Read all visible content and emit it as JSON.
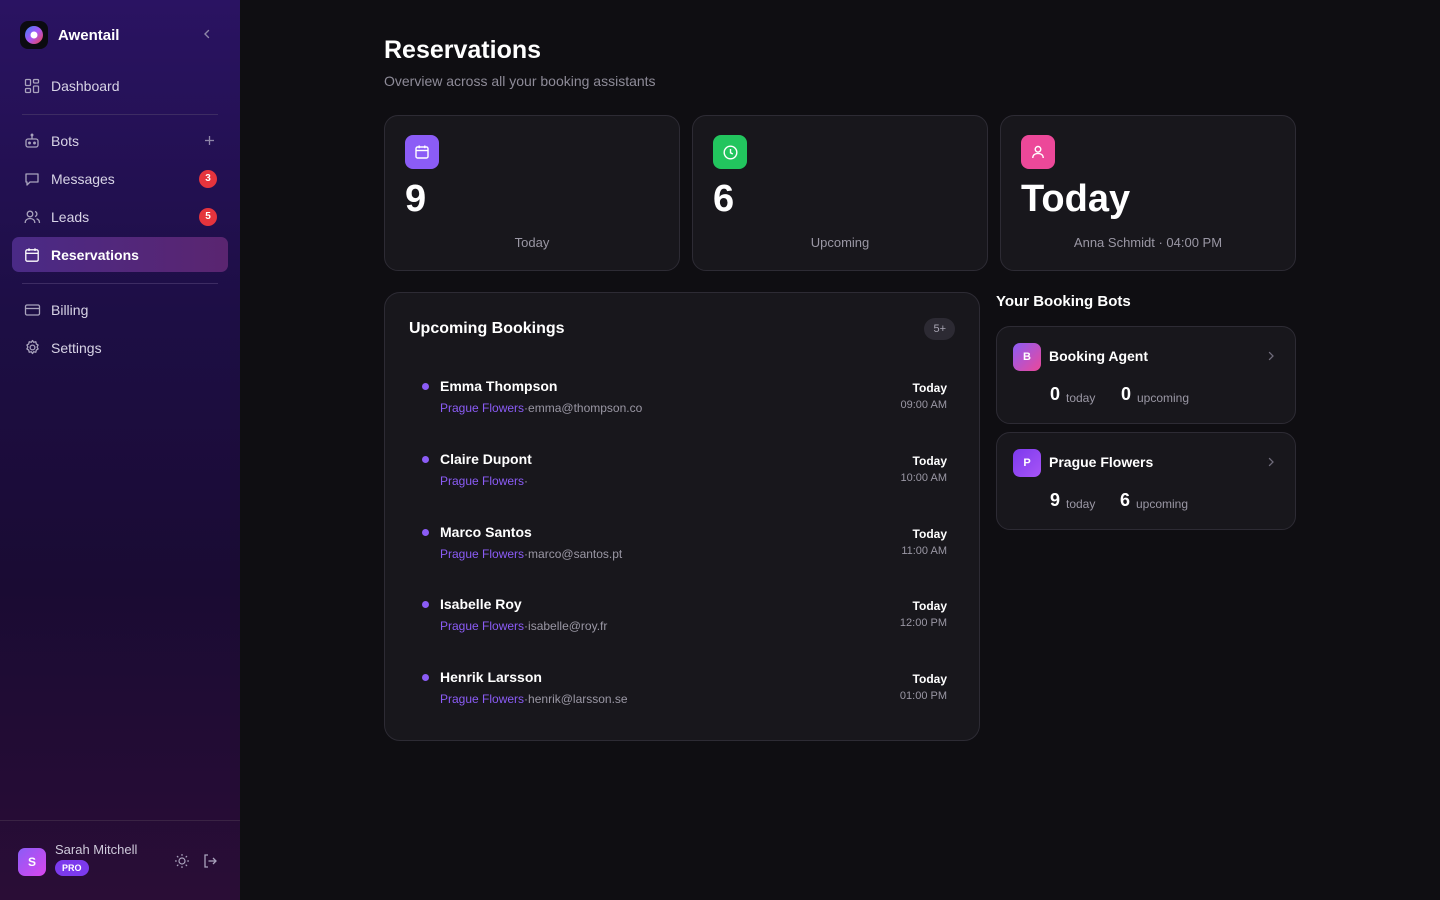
{
  "app": {
    "name": "Awentail"
  },
  "sidebar": {
    "items": [
      {
        "label": "Dashboard"
      },
      {
        "label": "Bots"
      },
      {
        "label": "Messages",
        "badge": "3"
      },
      {
        "label": "Leads",
        "badge": "5"
      },
      {
        "label": "Reservations"
      },
      {
        "label": "Billing"
      },
      {
        "label": "Settings"
      }
    ],
    "active": "Reservations"
  },
  "user": {
    "name": "Sarah Mitchell",
    "initial": "S",
    "plan": "PRO"
  },
  "page": {
    "title": "Reservations",
    "subtitle": "Overview across all your booking assistants"
  },
  "stats": [
    {
      "value": "9",
      "label": "Today",
      "icon": "calendar-icon",
      "color": "#8b5cf6"
    },
    {
      "value": "6",
      "label": "Upcoming",
      "icon": "clock-icon",
      "color": "#22c55e"
    },
    {
      "value": "Today",
      "label": "Anna Schmidt · 04:00 PM",
      "icon": "user-icon",
      "color": "#ec4899"
    }
  ],
  "bookings": {
    "title": "Upcoming Bookings",
    "count": "5+",
    "items": [
      {
        "name": "Emma Thompson",
        "bot": "Prague Flowers",
        "sep": "·",
        "email": "emma@thompson.co",
        "day": "Today",
        "time": "09:00 AM"
      },
      {
        "name": "Claire Dupont",
        "bot": "Prague Flowers",
        "sep": "·",
        "email": "",
        "day": "Today",
        "time": "10:00 AM"
      },
      {
        "name": "Marco Santos",
        "bot": "Prague Flowers",
        "sep": "·",
        "email": "marco@santos.pt",
        "day": "Today",
        "time": "11:00 AM"
      },
      {
        "name": "Isabelle Roy",
        "bot": "Prague Flowers",
        "sep": "·",
        "email": "isabelle@roy.fr",
        "day": "Today",
        "time": "12:00 PM"
      },
      {
        "name": "Henrik Larsson",
        "bot": "Prague Flowers",
        "sep": "·",
        "email": "henrik@larsson.se",
        "day": "Today",
        "time": "01:00 PM"
      }
    ]
  },
  "bots": {
    "title": "Your Booking Bots",
    "items": [
      {
        "initial": "B",
        "name": "Booking Agent",
        "today": "0",
        "today_label": "today",
        "upcoming": "0",
        "upcoming_label": "upcoming"
      },
      {
        "initial": "P",
        "name": "Prague Flowers",
        "today": "9",
        "today_label": "today",
        "upcoming": "6",
        "upcoming_label": "upcoming"
      }
    ]
  }
}
